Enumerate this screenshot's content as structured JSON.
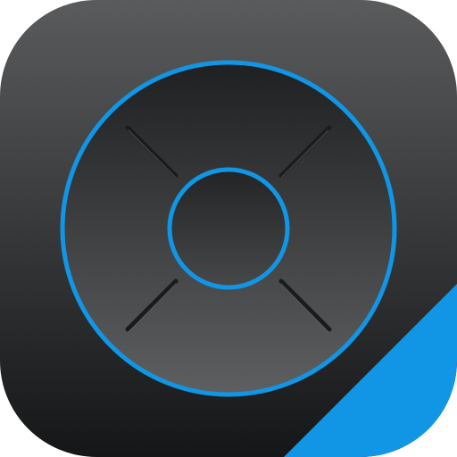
{
  "app_icon": {
    "icon": "directional-pad-icon",
    "colors": {
      "tile_top": "#5a5b5c",
      "tile_bottom": "#151617",
      "accent": "#1196e6",
      "ring_fill_top": "#1f2021",
      "ring_fill_bottom": "#5e5f60",
      "dpad_lines": "#1a1b1c"
    }
  }
}
